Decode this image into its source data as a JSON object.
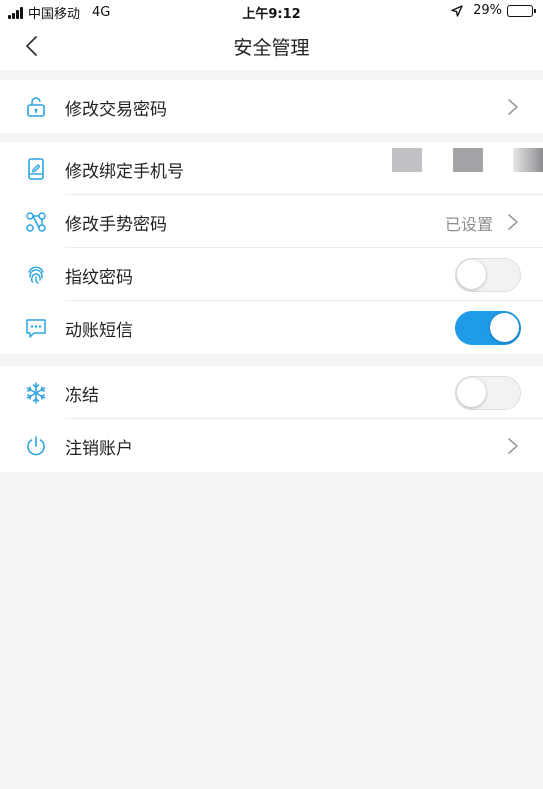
{
  "status": {
    "carrier": "中国移动",
    "network": "4G",
    "time": "上午9:12",
    "battery": "29%",
    "battery_level": 0.29
  },
  "nav": {
    "title": "安全管理",
    "back_icon": "chevron-left-icon"
  },
  "groups": [
    {
      "rows": [
        {
          "label": "修改交易密码",
          "icon": "lock-icon",
          "control": "chevron"
        }
      ]
    },
    {
      "rows": [
        {
          "label": "修改绑定手机号",
          "icon": "phone-edit-icon",
          "control": "masked"
        },
        {
          "label": "修改手势密码",
          "icon": "gesture-icon",
          "value": "已设置",
          "control": "chevron"
        },
        {
          "label": "指纹密码",
          "icon": "fingerprint-icon",
          "control": "toggle",
          "on": false
        },
        {
          "label": "动账短信",
          "icon": "sms-icon",
          "control": "toggle",
          "on": true
        }
      ]
    },
    {
      "rows": [
        {
          "label": "冻结",
          "icon": "snowflake-icon",
          "control": "toggle",
          "on": false
        },
        {
          "label": "注销账户",
          "icon": "power-icon",
          "control": "chevron"
        }
      ]
    }
  ],
  "colors": {
    "accent": "#1f9be8",
    "icon": "#2aa3e0",
    "background": "#f4f4f6"
  }
}
